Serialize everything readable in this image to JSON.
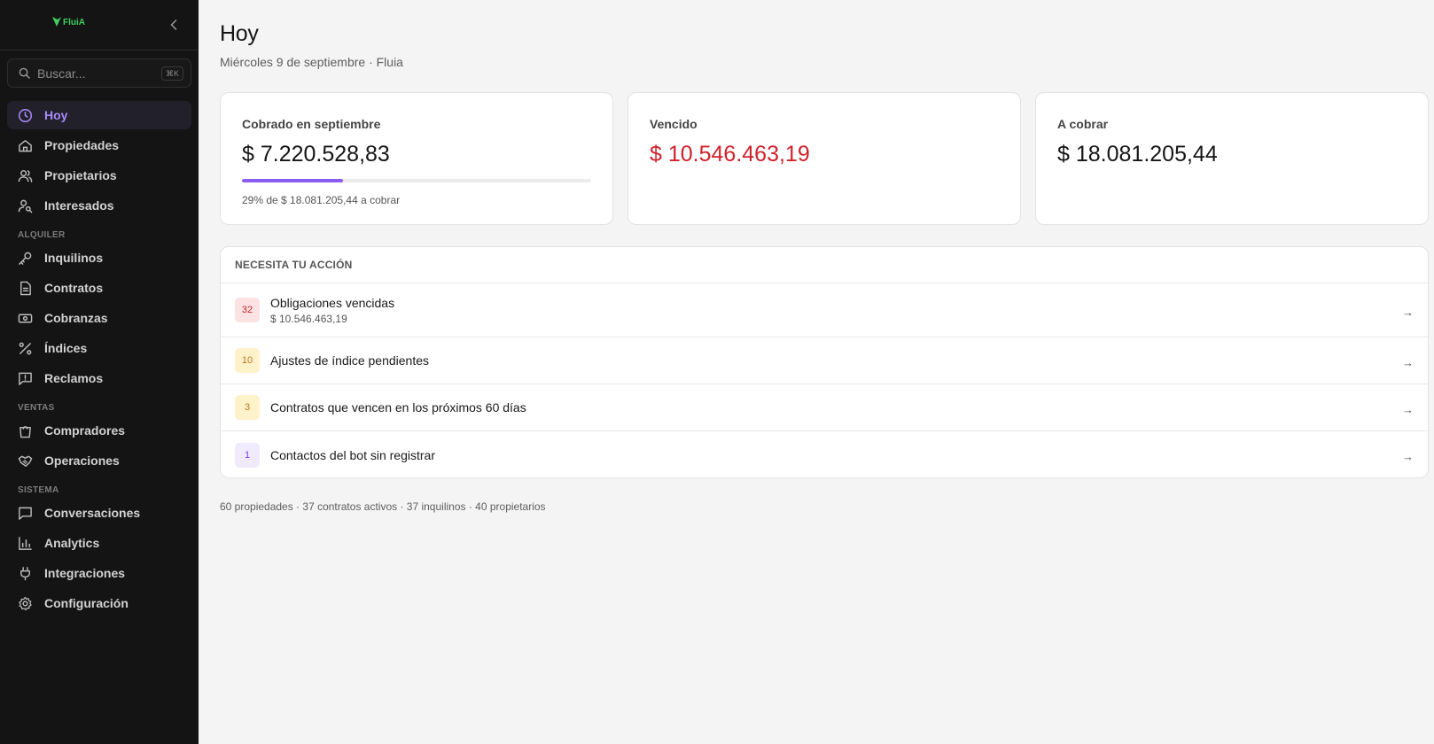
{
  "brand": {
    "name": "FluiA",
    "accent": "#3ecf5e"
  },
  "search": {
    "placeholder": "Buscar...",
    "shortcut": "⌘K"
  },
  "nav": {
    "main": [
      {
        "id": "hoy",
        "label": "Hoy",
        "icon": "clock-icon",
        "active": true
      },
      {
        "id": "propiedades",
        "label": "Propiedades",
        "icon": "building-icon"
      },
      {
        "id": "propietarios",
        "label": "Propietarios",
        "icon": "users-icon"
      },
      {
        "id": "interesados",
        "label": "Interesados",
        "icon": "user-search-icon"
      }
    ],
    "sections": [
      {
        "title": "ALQUILER",
        "items": [
          {
            "id": "inquilinos",
            "label": "Inquilinos",
            "icon": "key-icon"
          },
          {
            "id": "contratos",
            "label": "Contratos",
            "icon": "document-icon"
          },
          {
            "id": "cobranzas",
            "label": "Cobranzas",
            "icon": "banknote-icon"
          },
          {
            "id": "indices",
            "label": "Índices",
            "icon": "percent-icon"
          },
          {
            "id": "reclamos",
            "label": "Reclamos",
            "icon": "alert-message-icon"
          }
        ]
      },
      {
        "title": "VENTAS",
        "items": [
          {
            "id": "compradores",
            "label": "Compradores",
            "icon": "shopping-bag-icon"
          },
          {
            "id": "operaciones",
            "label": "Operaciones",
            "icon": "handshake-icon"
          }
        ]
      },
      {
        "title": "SISTEMA",
        "items": [
          {
            "id": "conversaciones",
            "label": "Conversaciones",
            "icon": "message-icon"
          },
          {
            "id": "analytics",
            "label": "Analytics",
            "icon": "bar-chart-icon"
          },
          {
            "id": "integraciones",
            "label": "Integraciones",
            "icon": "plug-icon"
          },
          {
            "id": "configuracion",
            "label": "Configuración",
            "icon": "gear-icon"
          }
        ]
      }
    ]
  },
  "page": {
    "title": "Hoy",
    "subtitle": "Miércoles 9 de septiembre · Fluia"
  },
  "cards": {
    "collected": {
      "label": "Cobrado en septiembre",
      "value": "$ 7.220.528,83",
      "progress_percent": 29,
      "note": "29% de $ 18.081.205,44 a cobrar"
    },
    "overdue": {
      "label": "Vencido",
      "value": "$ 10.546.463,19",
      "color": "#d0212b"
    },
    "receivable": {
      "label": "A cobrar",
      "value": "$ 18.081.205,44"
    }
  },
  "actions": {
    "title": "NECESITA TU ACCIÓN",
    "items": [
      {
        "count": "32",
        "title": "Obligaciones vencidas",
        "subtitle": "$ 10.546.463,19",
        "tone": "red"
      },
      {
        "count": "10",
        "title": "Ajustes de índice pendientes",
        "tone": "yellow"
      },
      {
        "count": "3",
        "title": "Contratos que vencen en los próximos 60 días",
        "tone": "yellow"
      },
      {
        "count": "1",
        "title": "Contactos del bot sin registrar",
        "tone": "purple"
      }
    ],
    "arrow": "→"
  },
  "footer": {
    "stats": "60 propiedades · 37 contratos activos · 37 inquilinos · 40 propietarios"
  }
}
